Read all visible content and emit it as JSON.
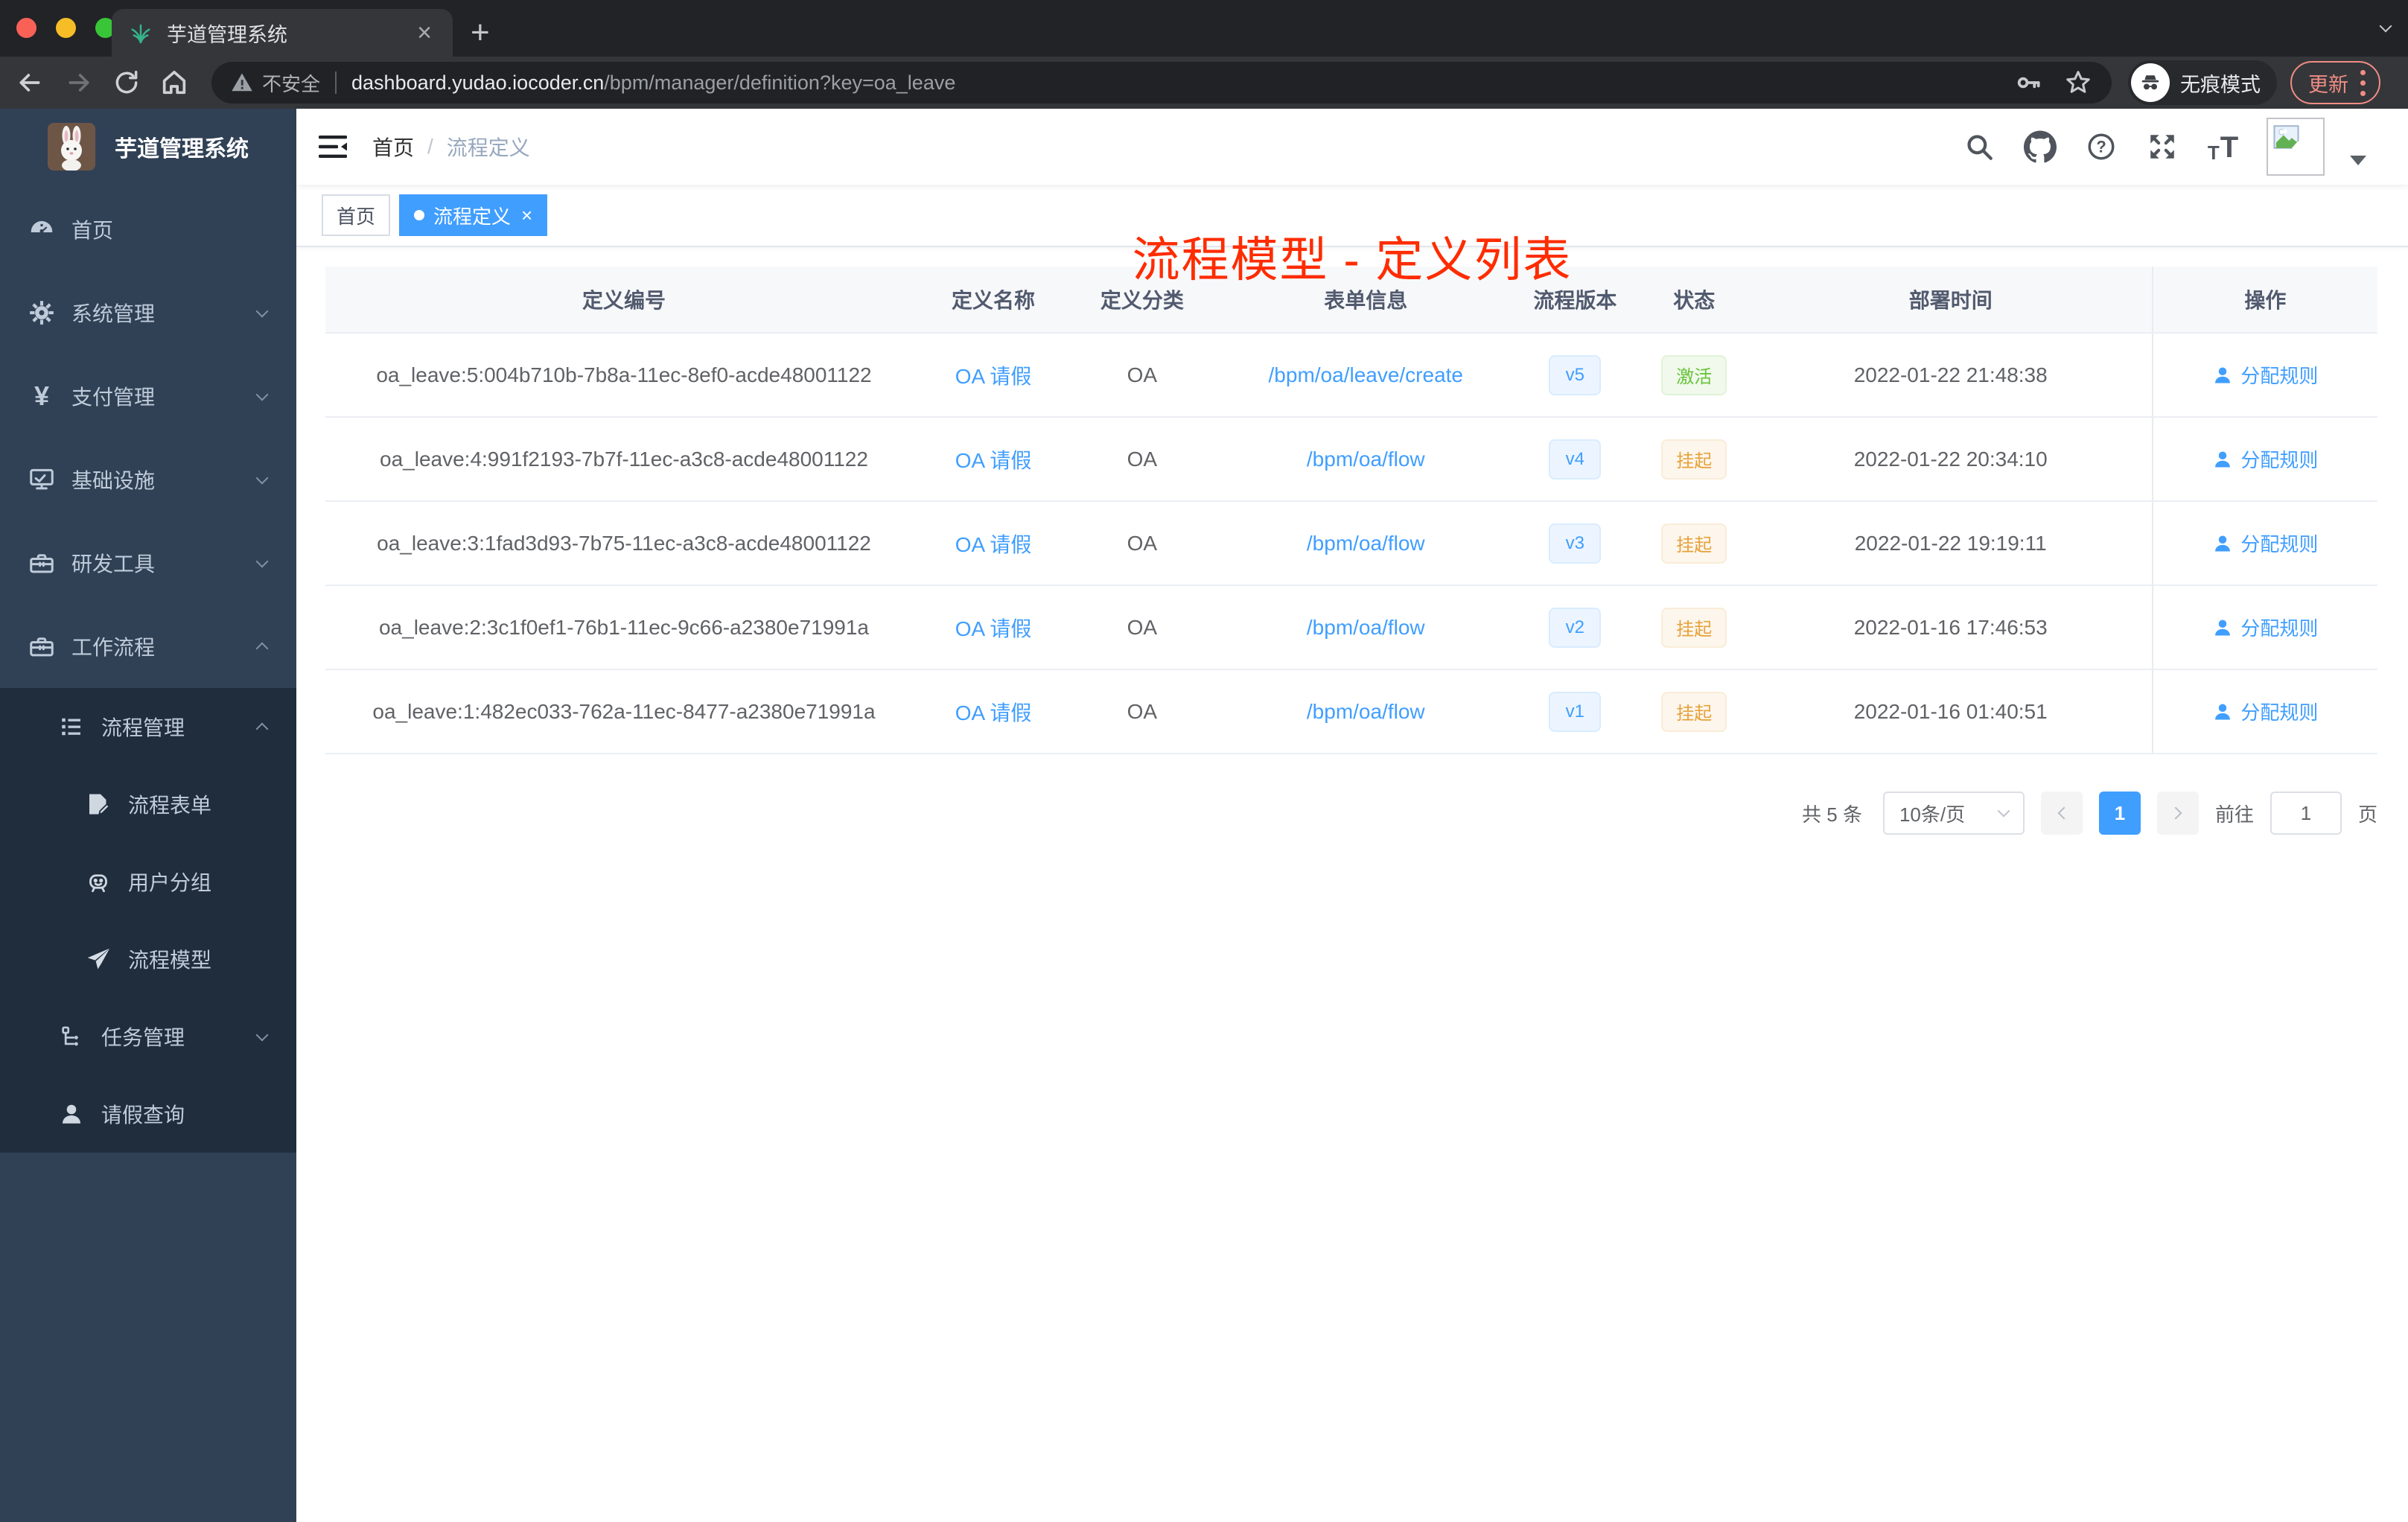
{
  "browser": {
    "tab_title": "芋道管理系统",
    "security_label": "不安全",
    "url_host": "dashboard.yudao.iocoder.cn",
    "url_path": "/bpm/manager/definition?key=oa_leave",
    "incognito_label": "无痕模式",
    "update_label": "更新"
  },
  "sidebar": {
    "brand": "芋道管理系统",
    "items": [
      {
        "label": "首页"
      },
      {
        "label": "系统管理"
      },
      {
        "label": "支付管理"
      },
      {
        "label": "基础设施"
      },
      {
        "label": "研发工具"
      },
      {
        "label": "工作流程"
      }
    ],
    "workflow": {
      "process": {
        "label": "流程管理"
      },
      "process_children": [
        {
          "label": "流程表单"
        },
        {
          "label": "用户分组"
        },
        {
          "label": "流程模型"
        }
      ],
      "task": {
        "label": "任务管理"
      },
      "leave": {
        "label": "请假查询"
      }
    }
  },
  "header": {
    "breadcrumb_home": "首页",
    "breadcrumb_current": "流程定义",
    "annotation": "流程模型 - 定义列表"
  },
  "tags": {
    "home": "首页",
    "active": "流程定义",
    "close": "×"
  },
  "table": {
    "headers": [
      "定义编号",
      "定义名称",
      "定义分类",
      "表单信息",
      "流程版本",
      "状态",
      "部署时间",
      "操作"
    ],
    "action_label": "分配规则",
    "rows": [
      {
        "id": "oa_leave:5:004b710b-7b8a-11ec-8ef0-acde48001122",
        "name": "OA 请假",
        "category": "OA",
        "form": "/bpm/oa/leave/create",
        "version": "v5",
        "status": "激活",
        "status_type": "active",
        "deploy_time": "2022-01-22 21:48:38"
      },
      {
        "id": "oa_leave:4:991f2193-7b7f-11ec-a3c8-acde48001122",
        "name": "OA 请假",
        "category": "OA",
        "form": "/bpm/oa/flow",
        "version": "v4",
        "status": "挂起",
        "status_type": "suspended",
        "deploy_time": "2022-01-22 20:34:10"
      },
      {
        "id": "oa_leave:3:1fad3d93-7b75-11ec-a3c8-acde48001122",
        "name": "OA 请假",
        "category": "OA",
        "form": "/bpm/oa/flow",
        "version": "v3",
        "status": "挂起",
        "status_type": "suspended",
        "deploy_time": "2022-01-22 19:19:11"
      },
      {
        "id": "oa_leave:2:3c1f0ef1-76b1-11ec-9c66-a2380e71991a",
        "name": "OA 请假",
        "category": "OA",
        "form": "/bpm/oa/flow",
        "version": "v2",
        "status": "挂起",
        "status_type": "suspended",
        "deploy_time": "2022-01-16 17:46:53"
      },
      {
        "id": "oa_leave:1:482ec033-762a-11ec-8477-a2380e71991a",
        "name": "OA 请假",
        "category": "OA",
        "form": "/bpm/oa/flow",
        "version": "v1",
        "status": "挂起",
        "status_type": "suspended",
        "deploy_time": "2022-01-16 01:40:51"
      }
    ]
  },
  "pagination": {
    "total": "共 5 条",
    "page_size": "10条/页",
    "current_page": "1",
    "goto_label": "前往",
    "page_unit": "页"
  },
  "colors": {
    "accent": "#409eff",
    "annotation_red": "#fe2c00",
    "success": "#67c23a",
    "warning": "#e6a23c",
    "sidebar_bg": "#304156",
    "sidebar_submenu_bg": "#1f2d3d"
  }
}
